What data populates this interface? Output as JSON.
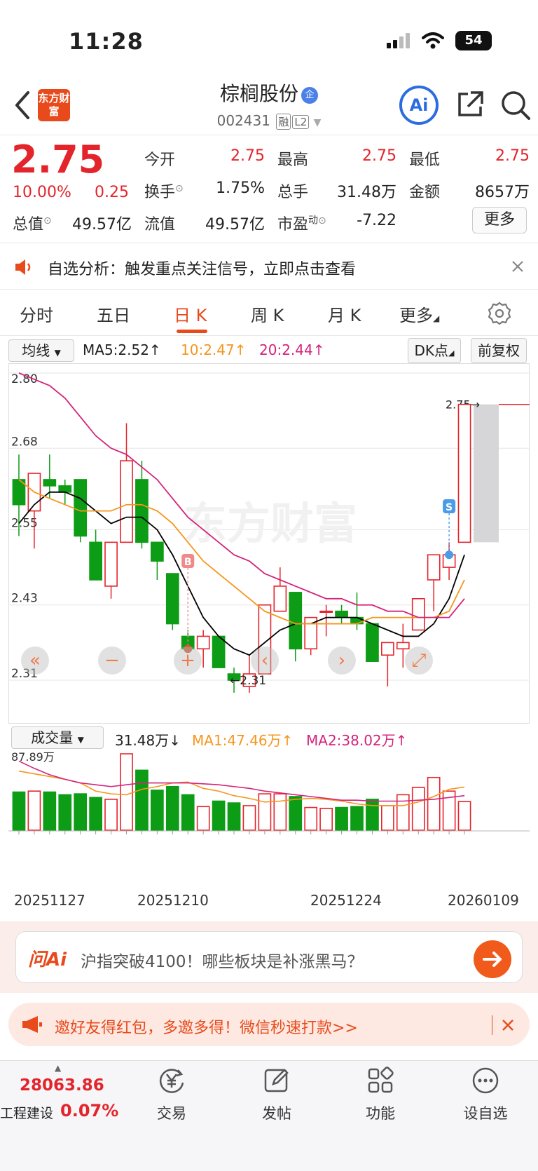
{
  "status": {
    "time": "11:28",
    "battery": "54"
  },
  "header": {
    "logo_text": "东方财富",
    "stock_name": "棕榈股份",
    "name_badge": "企",
    "stock_code": "002431",
    "tag1": "融",
    "tag2": "L2",
    "ai_label": "Ai"
  },
  "quote": {
    "price": "2.75",
    "change_pct": "10.00%",
    "change_amt": "0.25",
    "open_label": "今开",
    "open": "2.75",
    "high_label": "最高",
    "high": "2.75",
    "low_label": "最低",
    "low": "2.75",
    "turnover_label": "换手",
    "turnover": "1.75%",
    "volume_label": "总手",
    "volume": "31.48万",
    "amount_label": "金额",
    "amount": "8657万",
    "mktcap_label": "总值",
    "mktcap": "49.57亿",
    "float_label": "流值",
    "float_cap": "49.57亿",
    "pe_label": "市盈",
    "pe_sup": "动",
    "pe": "-7.22",
    "more_label": "更多"
  },
  "notice": {
    "text": "自选分析：触发重点关注信号，立即点击查看"
  },
  "tabs": [
    {
      "label": "分时"
    },
    {
      "label": "五日"
    },
    {
      "label": "日 K"
    },
    {
      "label": "周 K"
    },
    {
      "label": "月 K"
    },
    {
      "label": "更多"
    }
  ],
  "kline_controls": {
    "indicator": "均线",
    "ma5": "MA5:2.52↑",
    "ma10": "10:2.47↑",
    "ma20": "20:2.44↑",
    "dk": "DK点",
    "adjust": "前复权",
    "price_marker": "2.75",
    "low_marker": "2.31",
    "buy_marker": "B",
    "sell_marker": "S",
    "watermark": "东方财富"
  },
  "volume_controls": {
    "indicator": "成交量",
    "value": "31.48万↓",
    "ma1": "MA1:47.46万↑",
    "ma2": "MA2:38.02万↑",
    "axis_max": "87.89万"
  },
  "chart_data": [
    {
      "type": "candlestick",
      "title": "",
      "ylim": [
        2.31,
        2.8
      ],
      "y_ticks": [
        "2.80",
        "2.68",
        "2.55",
        "2.43",
        "2.31"
      ],
      "x_ticks": [
        "20251127",
        "20251210",
        "20251224",
        "20260109"
      ],
      "candles": [
        {
          "o": 2.63,
          "h": 2.67,
          "l": 2.54,
          "c": 2.59
        },
        {
          "o": 2.58,
          "h": 2.64,
          "l": 2.52,
          "c": 2.64
        },
        {
          "o": 2.63,
          "h": 2.67,
          "l": 2.6,
          "c": 2.62
        },
        {
          "o": 2.62,
          "h": 2.63,
          "l": 2.59,
          "c": 2.61
        },
        {
          "o": 2.63,
          "h": 2.63,
          "l": 2.53,
          "c": 2.54
        },
        {
          "o": 2.53,
          "h": 2.55,
          "l": 2.47,
          "c": 2.47
        },
        {
          "o": 2.46,
          "h": 2.53,
          "l": 2.44,
          "c": 2.53
        },
        {
          "o": 2.53,
          "h": 2.72,
          "l": 2.53,
          "c": 2.66
        },
        {
          "o": 2.63,
          "h": 2.66,
          "l": 2.52,
          "c": 2.53
        },
        {
          "o": 2.53,
          "h": 2.53,
          "l": 2.47,
          "c": 2.5
        },
        {
          "o": 2.48,
          "h": 2.48,
          "l": 2.39,
          "c": 2.4
        },
        {
          "o": 2.38,
          "h": 2.39,
          "l": 2.36,
          "c": 2.36
        },
        {
          "o": 2.36,
          "h": 2.39,
          "l": 2.33,
          "c": 2.38
        },
        {
          "o": 2.38,
          "h": 2.38,
          "l": 2.33,
          "c": 2.33
        },
        {
          "o": 2.32,
          "h": 2.33,
          "l": 2.29,
          "c": 2.31
        },
        {
          "o": 2.3,
          "h": 2.35,
          "l": 2.29,
          "c": 2.32
        },
        {
          "o": 2.32,
          "h": 2.43,
          "l": 2.32,
          "c": 2.43
        },
        {
          "o": 2.42,
          "h": 2.49,
          "l": 2.42,
          "c": 2.46
        },
        {
          "o": 2.45,
          "h": 2.45,
          "l": 2.34,
          "c": 2.36
        },
        {
          "o": 2.36,
          "h": 2.41,
          "l": 2.35,
          "c": 2.41
        },
        {
          "o": 2.42,
          "h": 2.43,
          "l": 2.38,
          "c": 2.42
        },
        {
          "o": 2.42,
          "h": 2.43,
          "l": 2.4,
          "c": 2.41
        },
        {
          "o": 2.41,
          "h": 2.45,
          "l": 2.39,
          "c": 2.4
        },
        {
          "o": 2.4,
          "h": 2.4,
          "l": 2.34,
          "c": 2.34
        },
        {
          "o": 2.35,
          "h": 2.37,
          "l": 2.3,
          "c": 2.37
        },
        {
          "o": 2.36,
          "h": 2.4,
          "l": 2.33,
          "c": 2.37
        },
        {
          "o": 2.39,
          "h": 2.44,
          "l": 2.39,
          "c": 2.44
        },
        {
          "o": 2.47,
          "h": 2.51,
          "l": 2.42,
          "c": 2.51
        },
        {
          "o": 2.49,
          "h": 2.53,
          "l": 2.47,
          "c": 2.51
        },
        {
          "o": 2.53,
          "h": 2.75,
          "l": 2.53,
          "c": 2.75
        }
      ],
      "series": [
        {
          "name": "MA5",
          "color": "#000000",
          "values": [
            2.56,
            2.59,
            2.61,
            2.61,
            2.6,
            2.58,
            2.56,
            2.57,
            2.57,
            2.55,
            2.51,
            2.46,
            2.41,
            2.38,
            2.36,
            2.35,
            2.37,
            2.39,
            2.4,
            2.4,
            2.41,
            2.41,
            2.41,
            2.4,
            2.39,
            2.38,
            2.38,
            2.4,
            2.44,
            2.51
          ]
        },
        {
          "name": "10",
          "color": "#f5961d",
          "values": [
            2.63,
            2.61,
            2.6,
            2.59,
            2.58,
            2.58,
            2.58,
            2.59,
            2.59,
            2.58,
            2.56,
            2.53,
            2.5,
            2.48,
            2.46,
            2.44,
            2.42,
            2.41,
            2.4,
            2.4,
            2.4,
            2.4,
            2.4,
            2.41,
            2.41,
            2.41,
            2.41,
            2.41,
            2.42,
            2.47
          ]
        },
        {
          "name": "20",
          "color": "#d4237a",
          "values": [
            2.8,
            2.79,
            2.78,
            2.76,
            2.73,
            2.7,
            2.68,
            2.67,
            2.65,
            2.63,
            2.6,
            2.57,
            2.55,
            2.53,
            2.51,
            2.5,
            2.48,
            2.47,
            2.46,
            2.45,
            2.44,
            2.44,
            2.43,
            2.43,
            2.42,
            2.42,
            2.41,
            2.41,
            2.41,
            2.44
          ]
        }
      ],
      "markers": [
        {
          "label": "B",
          "index": 11
        },
        {
          "label": "S",
          "index": 28
        }
      ]
    },
    {
      "type": "bar",
      "title": "",
      "ylim": [
        0,
        87.89
      ],
      "unit": "万",
      "values": [
        42,
        43,
        42,
        39,
        40,
        36,
        34,
        84,
        66,
        44,
        48,
        39,
        26,
        32,
        30,
        27,
        40,
        40,
        37,
        25,
        24,
        25,
        26,
        34,
        27,
        39,
        47,
        58,
        43,
        31.48
      ],
      "series": [
        {
          "name": "MA1",
          "color": "#f5961d",
          "values": [
            65,
            62,
            59,
            56,
            52,
            43,
            40,
            39,
            45,
            48,
            52,
            53,
            46,
            43,
            38,
            35,
            31,
            32,
            34,
            35,
            34,
            32,
            29,
            27,
            27,
            27,
            31,
            37,
            45,
            47.46
          ]
        },
        {
          "name": "MA2",
          "color": "#d4237a",
          "values": [
            76,
            68,
            61,
            56,
            52,
            50,
            48,
            50,
            52,
            52,
            52,
            52,
            51,
            50,
            48,
            46,
            43,
            41,
            39,
            37,
            35,
            33,
            33,
            32,
            32,
            32,
            33,
            34,
            36,
            38.02
          ]
        }
      ]
    }
  ],
  "ask_ai": {
    "logo": "问Ai",
    "text": "沪指突破4100！哪些板块是补涨黑马？"
  },
  "invite": {
    "text": "邀好友得红包，多邀多得！微信秒速打款>>"
  },
  "bottom": {
    "index_value": "28063.86",
    "index_name": "工程建设",
    "index_pct": "0.07%",
    "nav": [
      {
        "label": "交易"
      },
      {
        "label": "发帖"
      },
      {
        "label": "功能"
      },
      {
        "label": "设自选"
      }
    ]
  }
}
